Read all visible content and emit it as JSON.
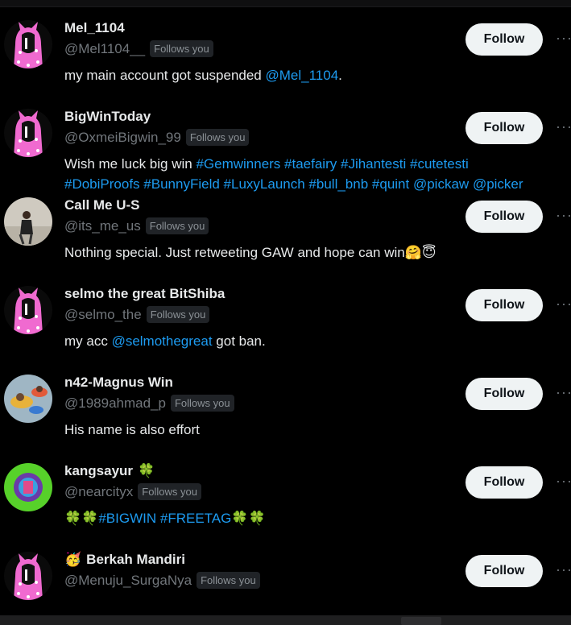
{
  "follow_label": "Follow",
  "follows_you_label": "Follows you",
  "more_label": "···",
  "colors": {
    "link": "#1d9bf0",
    "button_bg": "#eff3f4",
    "muted": "#71767b"
  },
  "accounts": [
    {
      "name": "Mel_1104",
      "name_emoji": "",
      "handle": "@Mel1104__",
      "follows_you": true,
      "avatar": "pink-hoodie-avatar",
      "bio": [
        {
          "t": "my main account got suspended "
        },
        {
          "t": "@Mel_1104",
          "link": true
        },
        {
          "t": "."
        }
      ],
      "bio2": []
    },
    {
      "name": "BigWinToday",
      "name_emoji": "",
      "handle": "@OxmeiBigwin_99",
      "follows_you": true,
      "avatar": "pink-hoodie-avatar",
      "bio": [
        {
          "t": "Wish me luck big win "
        },
        {
          "t": "#Gemwinners",
          "link": true
        },
        {
          "t": " "
        },
        {
          "t": "#taefairy",
          "link": true
        },
        {
          "t": " "
        },
        {
          "t": "#Jihantesti",
          "link": true
        },
        {
          "t": " "
        },
        {
          "t": "#cutetesti",
          "link": true
        }
      ],
      "bio2": [
        {
          "t": "#DobiProofs",
          "link": true
        },
        {
          "t": " "
        },
        {
          "t": "#BunnyField",
          "link": true
        },
        {
          "t": " "
        },
        {
          "t": "#LuxyLaunch",
          "link": true
        },
        {
          "t": " "
        },
        {
          "t": "#bull_bnb",
          "link": true
        },
        {
          "t": " "
        },
        {
          "t": "#quint",
          "link": true
        },
        {
          "t": " "
        },
        {
          "t": "@pickaw",
          "link": true
        },
        {
          "t": " "
        },
        {
          "t": "@picker",
          "link": true
        }
      ]
    },
    {
      "name": "Call Me U-S",
      "name_emoji": "",
      "handle": "@its_me_us",
      "follows_you": true,
      "avatar": "person-photo-avatar",
      "bio": [
        {
          "t": "Nothing special. Just retweeting GAW and hope can win"
        },
        {
          "t": "🤗😇",
          "emoji": true
        }
      ],
      "bio2": []
    },
    {
      "name": "selmo the great BitShiba",
      "name_emoji": "",
      "handle": "@selmo_the",
      "follows_you": true,
      "avatar": "pink-hoodie-avatar",
      "bio": [
        {
          "t": "my acc "
        },
        {
          "t": "@selmothegreat",
          "link": true
        },
        {
          "t": " got ban."
        }
      ],
      "bio2": []
    },
    {
      "name": "n42-Magnus Win",
      "name_emoji": "",
      "handle": "@1989ahmad_p",
      "follows_you": true,
      "avatar": "pool-photo-avatar",
      "bio": [
        {
          "t": "His name is also effort"
        }
      ],
      "bio2": []
    },
    {
      "name": "kangsayur",
      "name_emoji": "🍀",
      "handle": "@nearcityx",
      "follows_you": true,
      "avatar": "green-circle-avatar",
      "bio": [
        {
          "t": "🍀🍀",
          "emoji": true
        },
        {
          "t": "#BIGWIN",
          "link": true
        },
        {
          "t": " "
        },
        {
          "t": "#FREETAG",
          "link": true
        },
        {
          "t": "🍀🍀",
          "emoji": true
        }
      ],
      "bio2": []
    },
    {
      "name": "Berkah Mandiri",
      "name_emoji_before": "🥳",
      "name_emoji": "",
      "handle": "@Menuju_SurgaNya",
      "follows_you": true,
      "avatar": "pink-hoodie-avatar",
      "bio": [],
      "bio2": []
    }
  ]
}
